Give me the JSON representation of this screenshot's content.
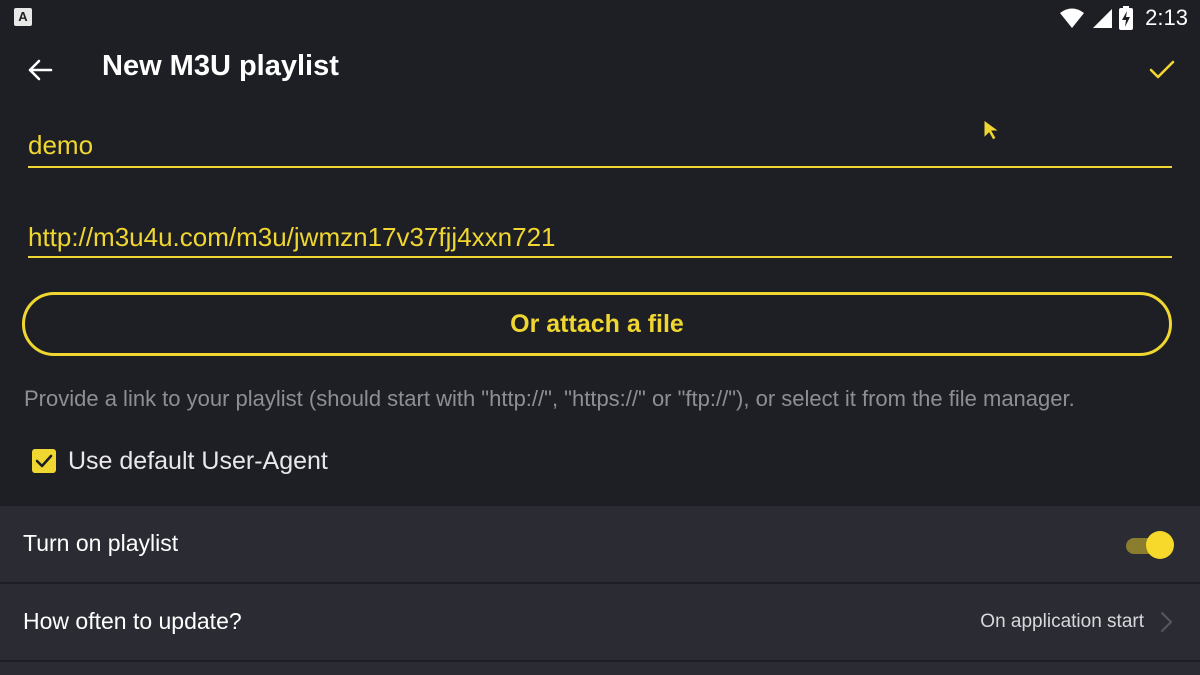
{
  "status_bar": {
    "app_icon_letter": "A",
    "time": "2:13",
    "icons": [
      "wifi-icon",
      "signal-icon",
      "battery-charging-icon"
    ]
  },
  "app_bar": {
    "title": "New M3U playlist",
    "back_icon": "arrow-left-icon",
    "confirm_icon": "check-icon"
  },
  "form": {
    "name_value": "demo",
    "url_value": "http://m3u4u.com/m3u/jwmzn17v37fjj4xxn721",
    "attach_label": "Or attach a file",
    "helper_text": "Provide a link to your playlist (should start with \"http://\", \"https://\" or \"ftp://\"), or select it from the file manager.",
    "user_agent_label": "Use default User-Agent",
    "user_agent_checked": true
  },
  "settings": {
    "turn_on_label": "Turn on playlist",
    "turn_on_enabled": true,
    "update_label": "How often to update?",
    "update_value": "On application start"
  },
  "colors": {
    "accent": "#f0d630",
    "background": "#1e1f24",
    "section_background": "#2b2c33",
    "helper_text": "#8d8f96"
  }
}
